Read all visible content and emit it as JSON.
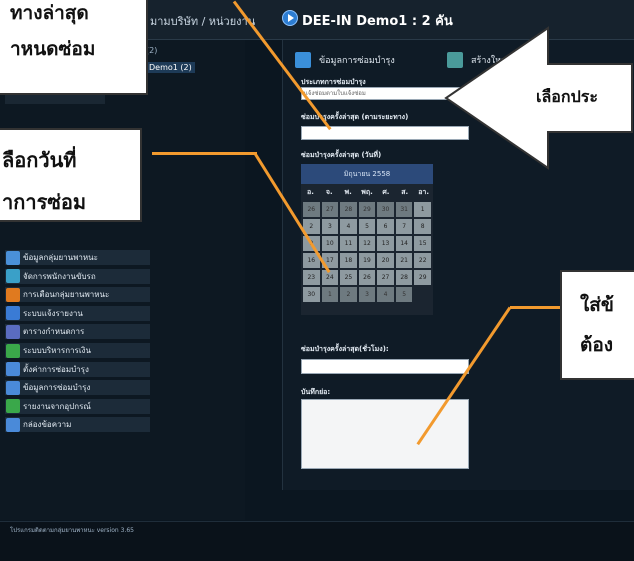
{
  "header": {
    "breadcrumb": "มามบริษัท / หน่วยงาน",
    "title": "DEE-IN Demo1 : 2 คัน"
  },
  "tree": {
    "count_item": "(2)",
    "selected_item": "Demo1 (2)"
  },
  "sidebar": {
    "items": [
      {
        "label": "ข้อมูลกลุ่มยานพาหนะ",
        "icon": "folder-icon",
        "color": "#4a90d9"
      },
      {
        "label": "จัดการพนักงานขับรถ",
        "icon": "driver-icon",
        "color": "#3aa0c8"
      },
      {
        "label": "การเตือนกลุ่มยานพาหนะ",
        "icon": "alert-icon",
        "color": "#e07a1f"
      },
      {
        "label": "ระบบแจ้งรายงาน",
        "icon": "report-icon",
        "color": "#3a7bd5"
      },
      {
        "label": "ตารางกำหนดการ",
        "icon": "calendar-icon",
        "color": "#5a6cc0"
      },
      {
        "label": "ระบบบริหารการเงิน",
        "icon": "money-icon",
        "color": "#3aa84a"
      },
      {
        "label": "ตั้งค่าการซ่อมบำรุง",
        "icon": "wrench-icon",
        "color": "#4a8ad9"
      },
      {
        "label": "ข้อมูลการซ่อมบำรุง",
        "icon": "repair-icon",
        "color": "#4a8ad9"
      },
      {
        "label": "รายงานจากอุปกรณ์",
        "icon": "device-icon",
        "color": "#3aa84a"
      },
      {
        "label": "กล่องข้อความ",
        "icon": "inbox-icon",
        "color": "#4a8ad9"
      }
    ]
  },
  "tabs": [
    {
      "label": "ข้อมูลการซ่อมบำรุง",
      "icon": "repair-tab-icon",
      "color": "#3a8fd9"
    },
    {
      "label": "สร้างใหม่ /",
      "icon": "create-tab-icon",
      "color": "#4a9a9a"
    }
  ],
  "form": {
    "type_label": "ประเภทการซ่อมบำรุง",
    "type_value": "แจ้งซ่อมตามใบแจ้งซ่อม",
    "last_mileage_label": "ซ่อมบำรุงครั้งล่าสุด (ตามระยะทาง)",
    "last_date_label": "ซ่อมบำรุงครั้งล่าสุด (วันที่)",
    "last_extra_label": "ซ่อมบำรุงครั้งล่าสุด(ชั่วโมง):",
    "note_label": "บันทึกย่อ:"
  },
  "calendar": {
    "month_label": "มิถุนายน 2558",
    "days": [
      "อ.",
      "จ.",
      "พ.",
      "พฤ.",
      "ศ.",
      "ส.",
      "อา."
    ],
    "cells": [
      "26",
      "27",
      "28",
      "29",
      "30",
      "31",
      "1",
      "2",
      "3",
      "4",
      "5",
      "6",
      "7",
      "8",
      "9",
      "10",
      "11",
      "12",
      "13",
      "14",
      "15",
      "16",
      "17",
      "18",
      "19",
      "20",
      "21",
      "22",
      "23",
      "24",
      "25",
      "26",
      "27",
      "28",
      "29",
      "30",
      "1",
      "2",
      "3",
      "4",
      "5"
    ],
    "dim_cells": [
      0,
      1,
      2,
      3,
      4,
      5,
      36,
      37,
      38,
      39,
      40
    ]
  },
  "footer": {
    "text": "โปรแกรมติดตามกลุ่มยานพาหนะ version 3.65"
  },
  "callouts": {
    "top_left_1": "ทางล่าสุด",
    "top_left_2": "าหนดซ่อม",
    "mid_left_1": "ลือกวันที่",
    "mid_left_2": "าการซ่อม",
    "arrow_text": "เลือกประ",
    "right_1": "ใส่ข้",
    "right_2": "ต้อง"
  },
  "colors": {
    "callout_line": "#f29a2e",
    "calendar_header": "#2c4a7a",
    "background": "#0b1620"
  }
}
